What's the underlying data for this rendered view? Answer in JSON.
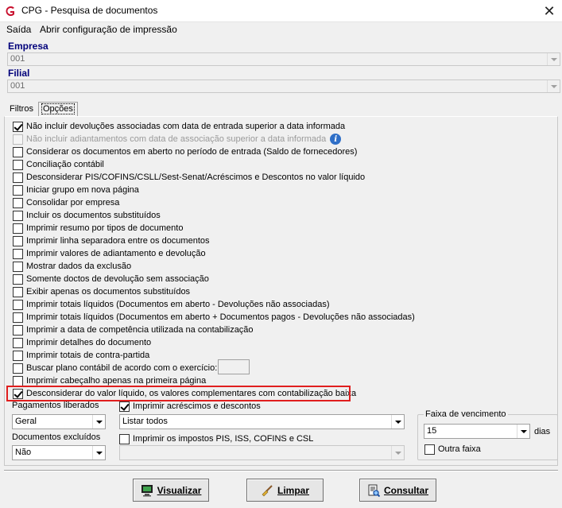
{
  "window": {
    "title": "CPG - Pesquisa de documentos"
  },
  "menu": {
    "items": [
      "Saída",
      "Abrir configuração de impressão"
    ]
  },
  "empresa": {
    "label": "Empresa",
    "value": "001"
  },
  "filial": {
    "label": "Filial",
    "value": "001"
  },
  "tabs": [
    {
      "label": "Filtros"
    },
    {
      "label": "Opções"
    }
  ],
  "options": [
    {
      "label": "Não incluir devoluções associadas com data de entrada superior a data informada",
      "checked": true
    },
    {
      "label": "Não incluir adiantamentos com data de associação superior a data informada",
      "checked": false,
      "disabled": true
    },
    {
      "label": "Considerar os documentos em aberto no período de entrada (Saldo de fornecedores)",
      "checked": false
    },
    {
      "label": "Conciliação contábil",
      "checked": false
    },
    {
      "label": "Desconsiderar PIS/COFINS/CSLL/Sest-Senat/Acréscimos e Descontos no valor líquido",
      "checked": false
    },
    {
      "label": "Iniciar grupo em nova página",
      "checked": false
    },
    {
      "label": "Consolidar por empresa",
      "checked": false
    },
    {
      "label": "Incluir os documentos substituídos",
      "checked": false
    },
    {
      "label": "Imprimir resumo por tipos de documento",
      "checked": false
    },
    {
      "label": "Imprimir linha separadora entre os documentos",
      "checked": false
    },
    {
      "label": "Imprimir valores de adiantamento e devolução",
      "checked": false
    },
    {
      "label": "Mostrar dados da exclusão",
      "checked": false
    },
    {
      "label": "Somente doctos de devolução sem associação",
      "checked": false
    },
    {
      "label": "Exibir apenas os documentos substituídos",
      "checked": false
    },
    {
      "label": "Imprimir totais líquidos (Documentos em aberto - Devoluções não associadas)",
      "checked": false
    },
    {
      "label": "Imprimir totais líquidos (Documentos em aberto + Documentos pagos - Devoluções não associadas)",
      "checked": false
    },
    {
      "label": "Imprimir a data de competência utilizada na contabilização",
      "checked": false
    },
    {
      "label": "Imprimir detalhes do documento",
      "checked": false
    },
    {
      "label": "Imprimir totais de contra-partida",
      "checked": false
    },
    {
      "label": "Buscar plano contábil de acordo com o exercício:",
      "checked": false
    },
    {
      "label": "Imprimir cabeçalho apenas na primeira página",
      "checked": false
    },
    {
      "label": "Desconsiderar do valor líquido, os valores complementares com contabilização baixa",
      "checked": true
    }
  ],
  "pagamentos": {
    "label": "Pagamentos liberados",
    "value": "Geral"
  },
  "documentos_excluidos": {
    "label": "Documentos excluídos",
    "value": "Não"
  },
  "acrescimos": {
    "label": "Imprimir acréscimos e descontos",
    "checked": true,
    "value": "Listar todos"
  },
  "impostos": {
    "label": "Imprimir os impostos PIS, ISS, COFINS e CSL",
    "checked": false,
    "value": ""
  },
  "faixa": {
    "title": "Faixa de vencimento",
    "value": "15",
    "unit": "dias",
    "outra_label": "Outra faixa",
    "outra_checked": false
  },
  "buttons": {
    "visualizar": "Visualizar",
    "limpar": "Limpar",
    "consultar": "Consultar"
  },
  "colors": {
    "label_blue": "#00007a",
    "highlight": "#e01e1e",
    "app_icon": "#c8102e"
  }
}
